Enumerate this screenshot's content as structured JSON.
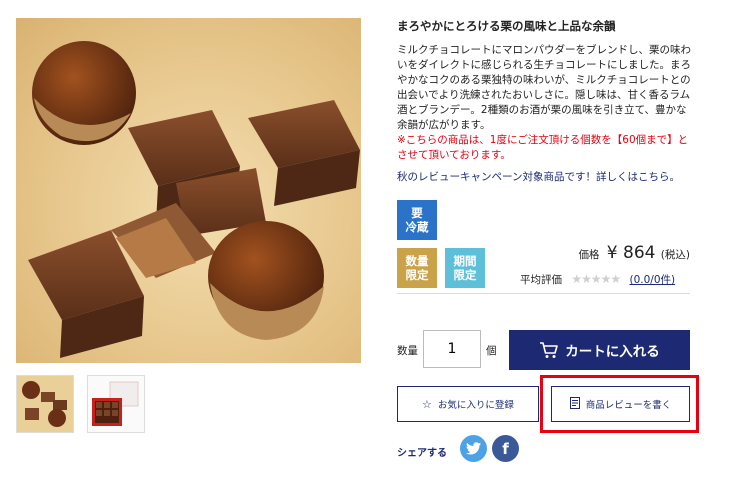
{
  "product": {
    "title": "まろやかにとろける栗の風味と上品な余韻",
    "description": "ミルクチョコレートにマロンパウダーをブレンドし、栗の味わいをダイレクトに感じられる生チョコレートにしました。まろやかなコクのある栗独特の味わいが、ミルクチョコレートとの出会いでより洗練されたおいしさに。隠し味は、甘く香るラム酒とブランデー。2種類のお酒が栗の風味を引き立て、豊かな余韻が広がります。",
    "notice": "※こちらの商品は、1度にご注文頂ける個数を【60個まで】とさせて頂いております。",
    "campaign_link": "秋のレビューキャンペーン対象商品です！詳しくはこちら。"
  },
  "badges": {
    "refrigerate": "要\n冷蔵",
    "limited_qty": "数量\n限定",
    "limited_period": "期間\n限定"
  },
  "price": {
    "label": "価格",
    "value": "¥ 864",
    "tax": "(税込)"
  },
  "rating": {
    "label": "平均評価",
    "stars": "★★★★★",
    "link": "(0.0/0件)",
    "score": 0
  },
  "purchase": {
    "qty_label": "数量",
    "qty_value": "1",
    "qty_unit": "個",
    "cart_button": "カートに入れる"
  },
  "actions": {
    "favorite_button": "お気に入りに登録",
    "review_button": "商品レビューを書く"
  },
  "share": {
    "label": "シェアする"
  },
  "colors": {
    "navy": "#1d2a73",
    "notice_red": "#e60012",
    "badge_blue": "#2a73c9",
    "badge_gold": "#c9a24a",
    "badge_cyan": "#5ec0d8",
    "twitter": "#4da1e6",
    "facebook": "#3b5998"
  }
}
